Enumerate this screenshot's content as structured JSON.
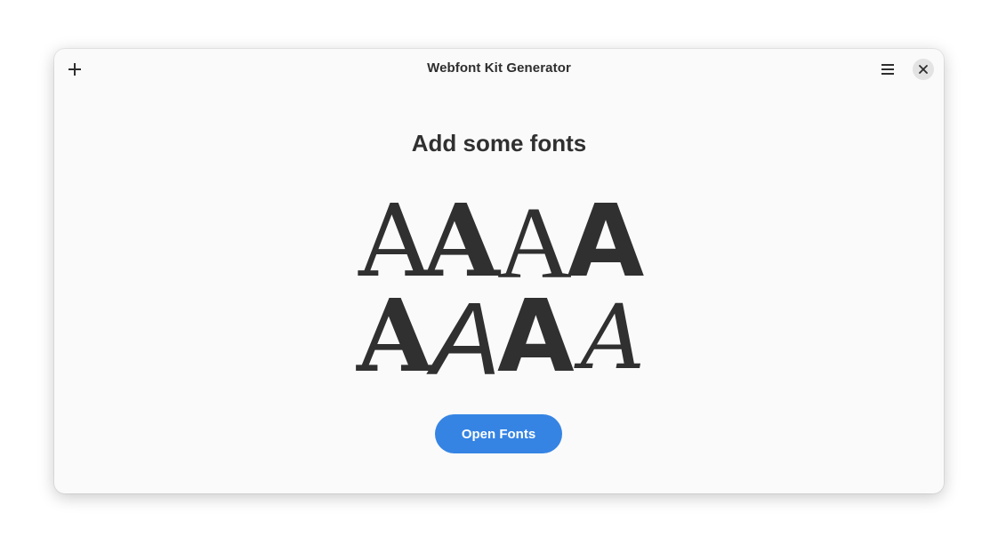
{
  "window": {
    "title": "Webfont Kit Generator"
  },
  "headerbar": {
    "add_icon": "plus-icon",
    "menu_icon": "hamburger-menu-icon",
    "close_icon": "close-icon"
  },
  "main": {
    "heading": "Add some fonts",
    "open_button_label": "Open Fonts",
    "glyph_samples": [
      "A",
      "A",
      "A",
      "A",
      "A",
      "A",
      "A",
      "A"
    ]
  },
  "colors": {
    "accent": "#3584e4",
    "text": "#303030",
    "window_bg": "#fafafa"
  }
}
